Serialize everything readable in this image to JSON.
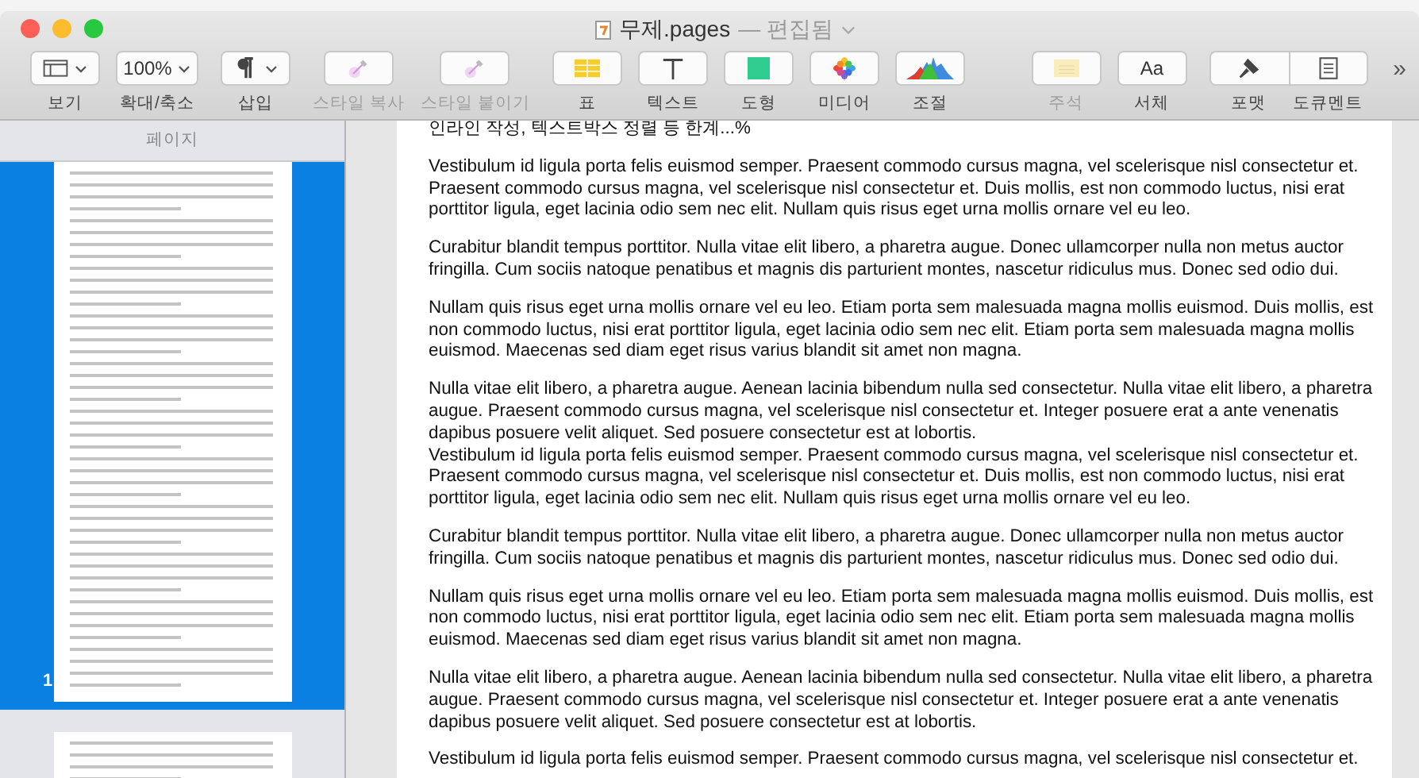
{
  "window": {
    "title": "무제.pages",
    "status": "— 편집됨"
  },
  "toolbar": {
    "groups": [
      {
        "items": [
          {
            "label": "보기",
            "kind": "view",
            "dropdown": true,
            "disabled": false
          },
          {
            "label": "확대/축소",
            "value": "100%",
            "dropdown": true,
            "disabled": false
          }
        ]
      },
      {
        "items": [
          {
            "label": "삽입",
            "kind": "pilcrow",
            "dropdown": true,
            "disabled": false
          }
        ]
      },
      {
        "items": [
          {
            "label": "스타일 복사",
            "kind": "eyedropper",
            "dropdown": false,
            "disabled": true
          },
          {
            "label": "스타일 붙이기",
            "kind": "eyedropper",
            "dropdown": false,
            "disabled": true
          }
        ]
      },
      {
        "items": [
          {
            "label": "표",
            "kind": "table",
            "dropdown": false,
            "disabled": false
          },
          {
            "label": "텍스트",
            "kind": "text",
            "dropdown": false,
            "disabled": false
          },
          {
            "label": "도형",
            "kind": "shape",
            "dropdown": false,
            "disabled": false
          },
          {
            "label": "미디어",
            "kind": "media",
            "dropdown": false,
            "disabled": false
          },
          {
            "label": "조절",
            "kind": "chart",
            "dropdown": false,
            "disabled": false
          }
        ]
      },
      {
        "items": [
          {
            "label": "주석",
            "kind": "comment",
            "dropdown": false,
            "disabled": true
          },
          {
            "label": "서체",
            "value": "Aa",
            "dropdown": false,
            "disabled": false
          }
        ]
      },
      {
        "items": [
          {
            "label": "포맷",
            "kind": "brush",
            "dropdown": false,
            "disabled": false
          },
          {
            "label": "도큐멘트",
            "kind": "document",
            "dropdown": false,
            "disabled": false
          }
        ]
      }
    ],
    "overflow": "»"
  },
  "sidebar": {
    "title": "페이지",
    "thumbnails": [
      {
        "number": "1",
        "selected": true
      },
      {
        "selected": false
      }
    ]
  },
  "document": {
    "blocks": [
      [
        "인라인 작성, 텍스트박스 정렬 등 한계...%"
      ],
      [
        "Vestibulum id ligula porta felis euismod semper. Praesent commodo cursus magna, vel scelerisque nisl consectetur et.",
        "Praesent commodo cursus magna, vel scelerisque nisl consectetur et. Duis mollis, est non commodo luctus, nisi erat",
        "porttitor ligula, eget lacinia odio sem nec elit. Nullam quis risus eget urna mollis ornare vel eu leo."
      ],
      [
        "Curabitur blandit tempus porttitor. Nulla vitae elit libero, a pharetra augue. Donec ullamcorper nulla non metus auctor",
        "fringilla. Cum sociis natoque penatibus et magnis dis parturient montes, nascetur ridiculus mus. Donec sed odio dui."
      ],
      [
        "Nullam quis risus eget urna mollis ornare vel eu leo. Etiam porta sem malesuada magna mollis euismod. Duis mollis, est",
        "non commodo luctus, nisi erat porttitor ligula, eget lacinia odio sem nec elit. Etiam porta sem malesuada magna mollis",
        "euismod. Maecenas sed diam eget risus varius blandit sit amet non magna."
      ],
      [
        "Nulla vitae elit libero, a pharetra augue. Aenean lacinia bibendum nulla sed consectetur. Nulla vitae elit libero, a pharetra",
        "augue. Praesent commodo cursus magna, vel scelerisque nisl consectetur et. Integer posuere erat a ante venenatis",
        "dapibus posuere velit aliquet. Sed posuere consectetur est at lobortis.",
        "Vestibulum id ligula porta felis euismod semper. Praesent commodo cursus magna, vel scelerisque nisl consectetur et.",
        "Praesent commodo cursus magna, vel scelerisque nisl consectetur et. Duis mollis, est non commodo luctus, nisi erat",
        "porttitor ligula, eget lacinia odio sem nec elit. Nullam quis risus eget urna mollis ornare vel eu leo."
      ],
      [
        "Curabitur blandit tempus porttitor. Nulla vitae elit libero, a pharetra augue. Donec ullamcorper nulla non metus auctor",
        "fringilla. Cum sociis natoque penatibus et magnis dis parturient montes, nascetur ridiculus mus. Donec sed odio dui."
      ],
      [
        "Nullam quis risus eget urna mollis ornare vel eu leo. Etiam porta sem malesuada magna mollis euismod. Duis mollis, est",
        "non commodo luctus, nisi erat porttitor ligula, eget lacinia odio sem nec elit. Etiam porta sem malesuada magna mollis",
        "euismod. Maecenas sed diam eget risus varius blandit sit amet non magna."
      ],
      [
        "Nulla vitae elit libero, a pharetra augue. Aenean lacinia bibendum nulla sed consectetur. Nulla vitae elit libero, a pharetra",
        "augue. Praesent commodo cursus magna, vel scelerisque nisl consectetur et. Integer posuere erat a ante venenatis",
        "dapibus posuere velit aliquet. Sed posuere consectetur est at lobortis."
      ],
      [
        "Vestibulum id ligula porta felis euismod semper. Praesent commodo cursus magna, vel scelerisque nisl consectetur et."
      ]
    ]
  }
}
